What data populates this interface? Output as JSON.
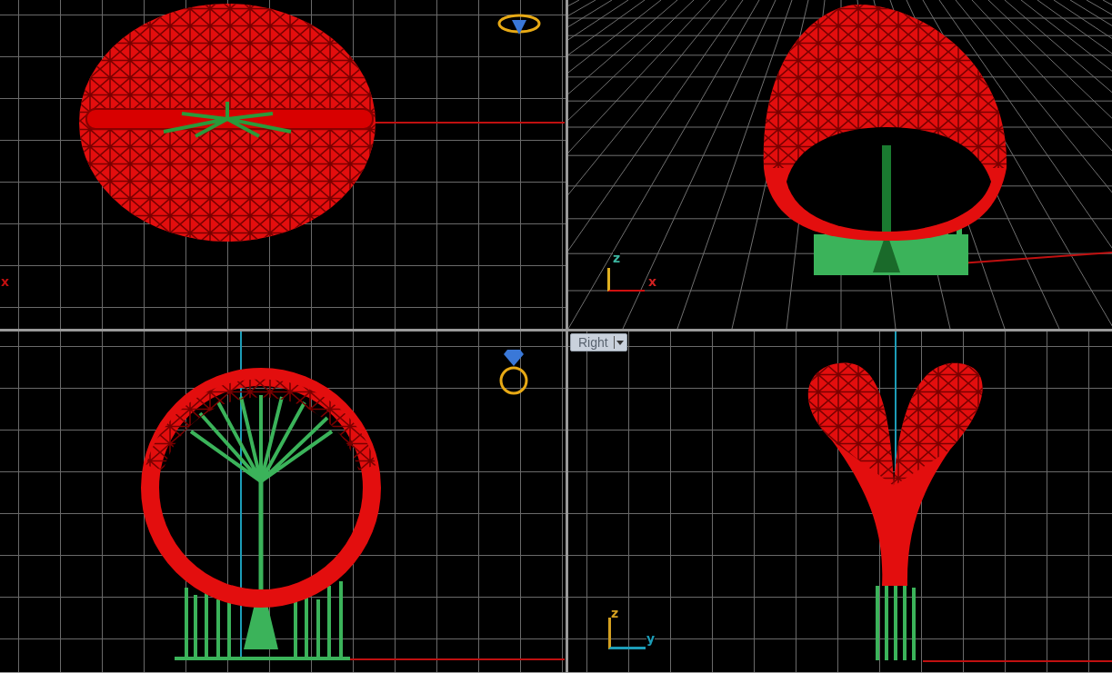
{
  "viewports": [
    {
      "kind": "top",
      "axes": {
        "horizontal": "x"
      }
    },
    {
      "kind": "perspective",
      "axes": {
        "vertical": "z",
        "horizontal": "x"
      }
    },
    {
      "kind": "front"
    },
    {
      "kind": "right",
      "label": "Right",
      "axes": {
        "vertical": "z",
        "horizontal": "y"
      }
    }
  ]
}
